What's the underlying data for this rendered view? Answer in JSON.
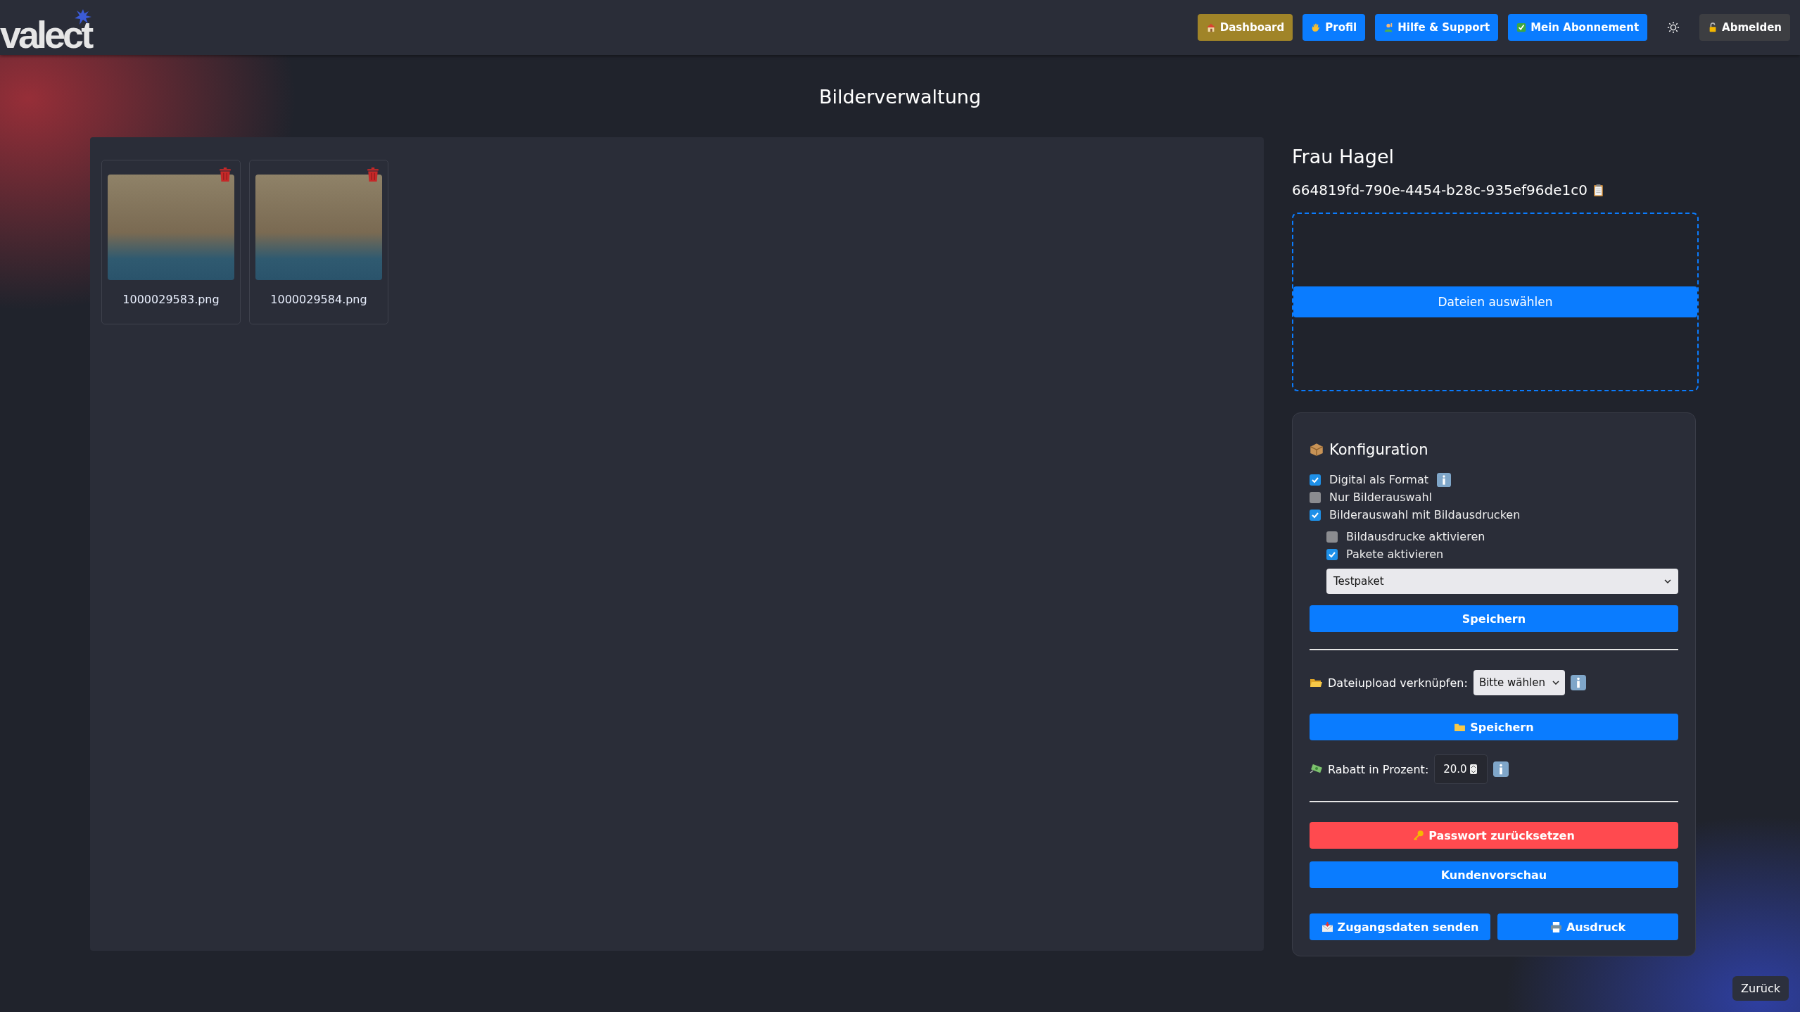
{
  "logo": {
    "text": "valect"
  },
  "nav": [
    {
      "label": "Dashboard",
      "kind": "warning"
    },
    {
      "label": "Profil",
      "kind": "primary"
    },
    {
      "label": "Hilfe & Support",
      "kind": "primary"
    },
    {
      "label": "Mein Abonnement",
      "kind": "primary"
    },
    {
      "label": "Abmelden",
      "kind": "dark"
    }
  ],
  "page_title": "Bilderverwaltung",
  "images": [
    {
      "filename": "1000029583.png"
    },
    {
      "filename": "1000029584.png"
    }
  ],
  "customer": {
    "name": "Frau Hagel",
    "id": "664819fd-790e-4454-b28c-935ef96de1c0"
  },
  "upload": {
    "button": "Dateien auswählen"
  },
  "config": {
    "title": "Konfiguration",
    "checkboxes": [
      {
        "label": "Digital als Format",
        "checked": true,
        "info": true
      },
      {
        "label": "Nur Bilderauswahl",
        "checked": false,
        "info": false
      },
      {
        "label": "Bilderauswahl mit Bildausdrucken",
        "checked": true,
        "info": false,
        "children": [
          {
            "label": "Bildausdrucke aktivieren",
            "checked": false
          },
          {
            "label": "Pakete aktivieren",
            "checked": true
          }
        ]
      }
    ],
    "package_select": {
      "value": "Testpaket"
    },
    "save_button": "Speichern",
    "upload_link": {
      "label": "Dateiupload verknüpfen:",
      "value": "Bitte wählen"
    },
    "upload_save_button": "Speichern",
    "discount": {
      "label": "Rabatt in Prozent:",
      "value": "20.0"
    },
    "actions": [
      {
        "label": "Passwort zurücksetzen",
        "kind": "danger"
      },
      {
        "label": "Kundenvorschau",
        "kind": "primary"
      }
    ],
    "bottom_actions": [
      {
        "label": "Zugangsdaten senden"
      },
      {
        "label": "Ausdruck"
      }
    ]
  },
  "back_button": "Zurück"
}
